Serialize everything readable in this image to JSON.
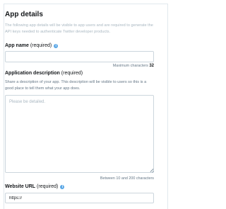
{
  "section": {
    "title": "App details",
    "intro": "The following app details will be visible to app users and are required to generate the API keys needed to authenticate Twitter developer products."
  },
  "app_name": {
    "label": "App name",
    "required": "(required)",
    "value": "",
    "placeholder": "",
    "hint_prefix": "Maximum characters",
    "hint_value": "32"
  },
  "description": {
    "label": "Application description",
    "required": "(required)",
    "help": "Share a description of your app. This description will be visible to users so this is a good place to tell them what your app does.",
    "placeholder": "Please be detailed.",
    "hint": "Between 10 and 200 characters"
  },
  "website": {
    "label": "Website URL",
    "required": "(required)",
    "value": "https://"
  },
  "colors": {
    "info_icon": "#5aa7e6",
    "border": "#ccd6dd",
    "muted_text": "#aab8c2"
  }
}
